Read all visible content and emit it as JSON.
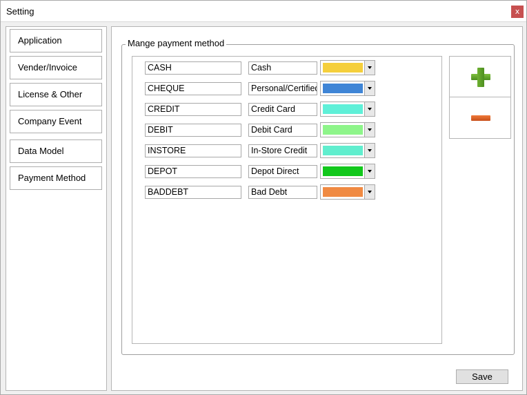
{
  "window": {
    "title": "Setting",
    "close_label": "x"
  },
  "sidebar": {
    "items": [
      {
        "label": "Application"
      },
      {
        "label": "Vender/Invoice"
      },
      {
        "label": "License & Other"
      },
      {
        "label": "Company Event"
      },
      {
        "label": "Data Model"
      },
      {
        "label": "Payment Method"
      }
    ]
  },
  "payment": {
    "group_title": "Mange payment method",
    "methods": [
      {
        "code": "CASH",
        "name": "Cash",
        "color": "#f5cf3c"
      },
      {
        "code": "CHEQUE",
        "name": "Personal/Certified",
        "color": "#3f85d6"
      },
      {
        "code": "CREDIT",
        "name": "Credit Card",
        "color": "#5ff0d8"
      },
      {
        "code": "DEBIT",
        "name": "Debit Card",
        "color": "#8ef58a"
      },
      {
        "code": "INSTORE",
        "name": "In-Store Credit",
        "color": "#60eece"
      },
      {
        "code": "DEPOT",
        "name": "Depot Direct",
        "color": "#12c81c"
      },
      {
        "code": "BADDEBT",
        "name": "Bad Debt",
        "color": "#f08a42"
      }
    ],
    "add_icon": "plus-icon",
    "remove_icon": "minus-icon"
  },
  "footer": {
    "save_label": "Save"
  }
}
